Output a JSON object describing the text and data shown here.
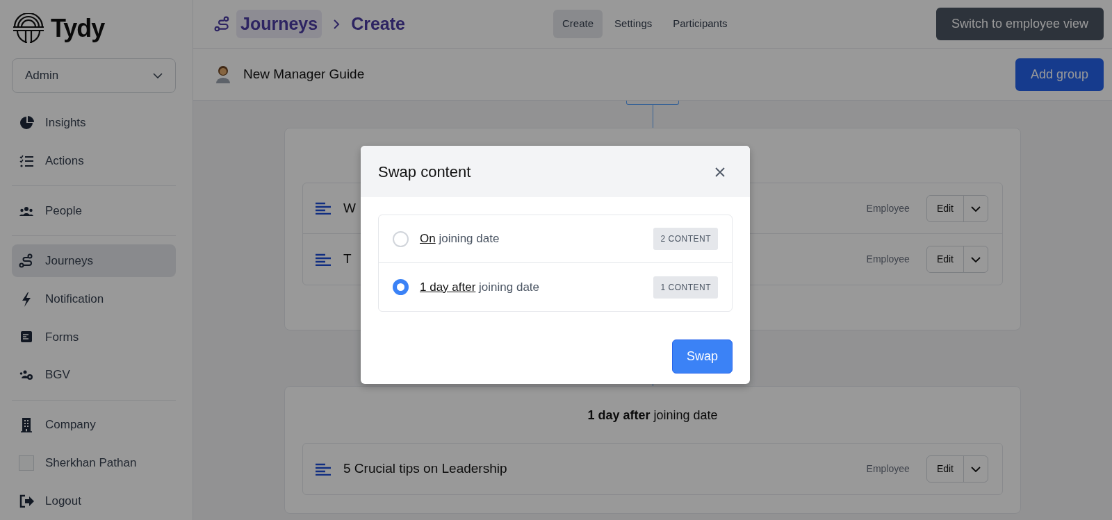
{
  "brand": {
    "name": "Tydy"
  },
  "role_select": {
    "value": "Admin"
  },
  "sidebar": {
    "groups": [
      [
        {
          "label": "Insights",
          "selected": false
        },
        {
          "label": "Actions",
          "selected": false
        }
      ],
      [
        {
          "label": "People",
          "selected": false
        }
      ],
      [
        {
          "label": "Journeys",
          "selected": true
        },
        {
          "label": "Notification",
          "selected": false
        },
        {
          "label": "Forms",
          "selected": false
        },
        {
          "label": "BGV",
          "selected": false
        }
      ],
      [
        {
          "label": "Company",
          "selected": false
        },
        {
          "label": "Sherkhan Pathan",
          "selected": false
        },
        {
          "label": "Logout",
          "selected": false
        }
      ]
    ]
  },
  "breadcrumb": [
    "Journeys",
    "Create"
  ],
  "tabs": [
    {
      "label": "Create",
      "selected": true
    },
    {
      "label": "Settings",
      "selected": false
    },
    {
      "label": "Participants",
      "selected": false
    }
  ],
  "switch_button": "Switch to employee view",
  "journey": {
    "title": "New Manager Guide",
    "add_button": "Add group"
  },
  "groups": [
    {
      "items": [
        {
          "title": "W",
          "audience": "Employee",
          "action": "Edit"
        },
        {
          "title": "T",
          "audience": "Employee",
          "action": "Edit"
        }
      ]
    },
    {
      "heading": "**1 day after** joining date",
      "items": [
        {
          "title": "5 Crucial tips on Leadership",
          "audience": "Employee",
          "action": "Edit"
        }
      ]
    }
  ],
  "modal": {
    "title": "Swap content",
    "options": [
      {
        "underlined": "On",
        "text": "joining date",
        "badge": "2 CONTENT",
        "selected": false
      },
      {
        "underlined": "1 day after",
        "text": "joining date",
        "badge": "1 CONTENT",
        "selected": true
      }
    ],
    "button": "Swap"
  }
}
